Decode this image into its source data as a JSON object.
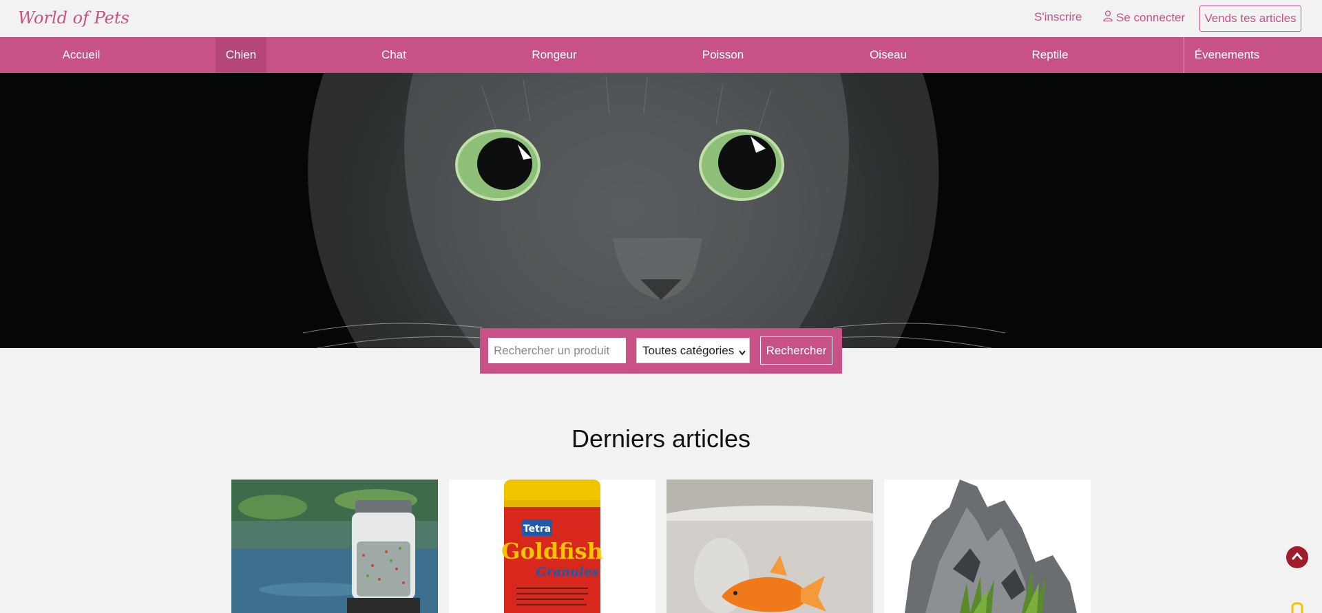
{
  "header": {
    "logo": "World of Pets",
    "signup": "S'inscrire",
    "login": "Se connecter",
    "sell": "Vends tes articles"
  },
  "nav": {
    "items": [
      {
        "label": "Accueil"
      },
      {
        "label": "Chien"
      },
      {
        "label": "Chat"
      },
      {
        "label": "Rongeur"
      },
      {
        "label": "Poisson"
      },
      {
        "label": "Oiseau"
      },
      {
        "label": "Reptile"
      },
      {
        "label": "Évenements"
      }
    ],
    "active": "Chien"
  },
  "search": {
    "placeholder": "Rechercher un produit",
    "category": "Toutes catégories",
    "button": "Rechercher"
  },
  "latest": {
    "title": "Derniers articles",
    "cards": [
      {
        "image": "automatic-fish-feeder"
      },
      {
        "image": "tetra-goldfish-granules",
        "brand": "Tetra",
        "product": "Goldfish",
        "variant": "Granules"
      },
      {
        "image": "goldfish-bowl"
      },
      {
        "image": "aquarium-rock-decoration"
      }
    ]
  },
  "colors": {
    "accent": "#c85288",
    "nav_active": "#b5467a",
    "scroll_top": "#9e1c2c",
    "background": "#f2f2f2"
  },
  "icons": {
    "login": "user-icon",
    "scroll_top": "chevron-up-icon",
    "select": "chevron-down-icon",
    "lock": "lock-icon"
  }
}
